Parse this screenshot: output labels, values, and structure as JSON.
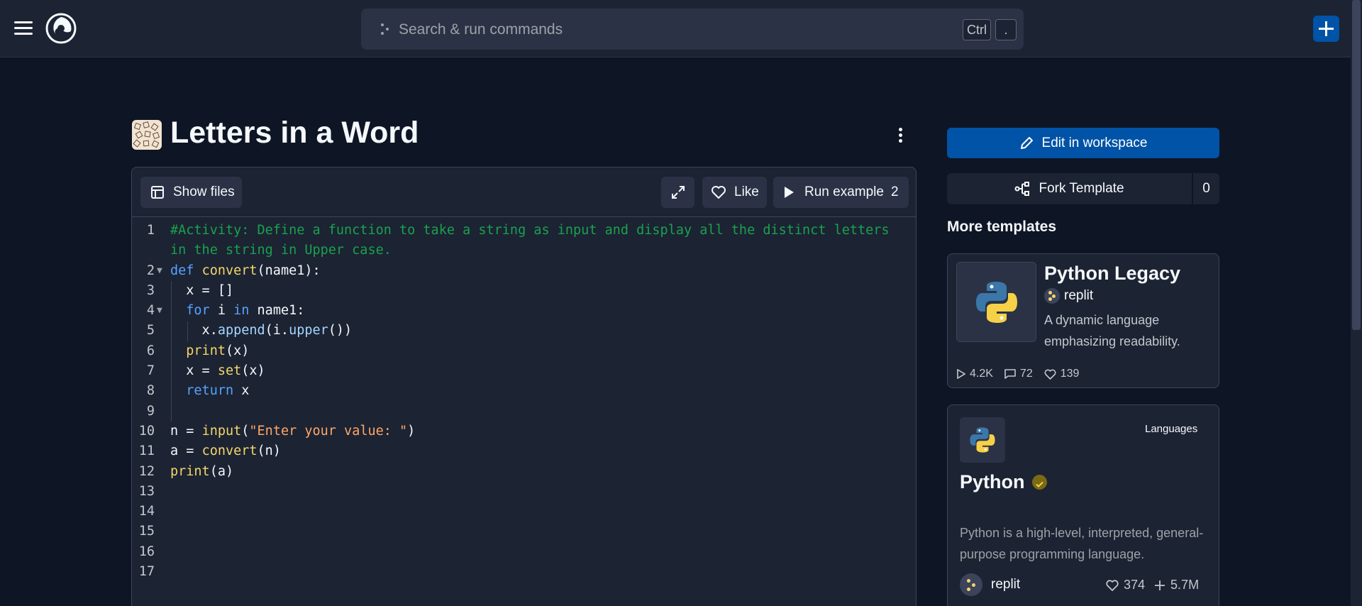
{
  "header": {
    "search_placeholder": "Search & run commands",
    "shortcut_ctrl": "Ctrl",
    "shortcut_key": "."
  },
  "page": {
    "title": "Letters in a Word"
  },
  "toolbar": {
    "show_files": "Show files",
    "like": "Like",
    "run_example": "Run example",
    "run_count": "2"
  },
  "code": {
    "lines": [
      {
        "n": "1",
        "fold": false,
        "tokens": [
          {
            "c": "c-comment",
            "t": "#Activity: Define a function to take a string as input and display all the distinct letters"
          }
        ]
      },
      {
        "n": "",
        "fold": false,
        "tokens": [
          {
            "c": "c-comment",
            "t": "in the string in Upper case."
          }
        ]
      },
      {
        "n": "2",
        "fold": true,
        "tokens": [
          {
            "c": "c-kw",
            "t": "def "
          },
          {
            "c": "c-fn",
            "t": "convert"
          },
          {
            "c": "c-plain",
            "t": "(name1):"
          }
        ]
      },
      {
        "n": "3",
        "fold": false,
        "tokens": [
          {
            "c": "c-plain",
            "t": "  x = []"
          }
        ]
      },
      {
        "n": "4",
        "fold": true,
        "tokens": [
          {
            "c": "c-plain",
            "t": "  "
          },
          {
            "c": "c-kw",
            "t": "for "
          },
          {
            "c": "c-plain",
            "t": "i "
          },
          {
            "c": "c-kw",
            "t": "in "
          },
          {
            "c": "c-plain",
            "t": "name1:"
          }
        ]
      },
      {
        "n": "5",
        "fold": false,
        "tokens": [
          {
            "c": "c-plain",
            "t": "    x."
          },
          {
            "c": "c-method",
            "t": "append"
          },
          {
            "c": "c-plain",
            "t": "(i."
          },
          {
            "c": "c-method",
            "t": "upper"
          },
          {
            "c": "c-plain",
            "t": "())"
          }
        ]
      },
      {
        "n": "6",
        "fold": false,
        "tokens": [
          {
            "c": "c-plain",
            "t": "  "
          },
          {
            "c": "c-fn",
            "t": "print"
          },
          {
            "c": "c-plain",
            "t": "(x)"
          }
        ]
      },
      {
        "n": "7",
        "fold": false,
        "tokens": [
          {
            "c": "c-plain",
            "t": "  x = "
          },
          {
            "c": "c-fn",
            "t": "set"
          },
          {
            "c": "c-plain",
            "t": "(x)"
          }
        ]
      },
      {
        "n": "8",
        "fold": false,
        "tokens": [
          {
            "c": "c-plain",
            "t": "  "
          },
          {
            "c": "c-kw",
            "t": "return "
          },
          {
            "c": "c-plain",
            "t": "x"
          }
        ]
      },
      {
        "n": "9",
        "fold": false,
        "tokens": []
      },
      {
        "n": "10",
        "fold": false,
        "tokens": [
          {
            "c": "c-plain",
            "t": "n = "
          },
          {
            "c": "c-fn",
            "t": "input"
          },
          {
            "c": "c-plain",
            "t": "("
          },
          {
            "c": "c-str",
            "t": "\"Enter your value: \""
          },
          {
            "c": "c-plain",
            "t": ")"
          }
        ]
      },
      {
        "n": "11",
        "fold": false,
        "tokens": [
          {
            "c": "c-plain",
            "t": "a = "
          },
          {
            "c": "c-fn",
            "t": "convert"
          },
          {
            "c": "c-plain",
            "t": "(n)"
          }
        ]
      },
      {
        "n": "12",
        "fold": false,
        "tokens": [
          {
            "c": "c-fn",
            "t": "print"
          },
          {
            "c": "c-plain",
            "t": "(a)"
          }
        ]
      },
      {
        "n": "13",
        "fold": false,
        "tokens": []
      },
      {
        "n": "14",
        "fold": false,
        "tokens": []
      },
      {
        "n": "15",
        "fold": false,
        "tokens": []
      },
      {
        "n": "16",
        "fold": false,
        "tokens": []
      },
      {
        "n": "17",
        "fold": false,
        "tokens": []
      }
    ]
  },
  "sidebar": {
    "edit_label": "Edit in workspace",
    "fork_label": "Fork Template",
    "fork_count": "0",
    "more_heading": "More templates",
    "card1": {
      "name": "Python Legacy",
      "owner": "replit",
      "description": "A dynamic language emphasizing readability.",
      "runs": "4.2K",
      "comments": "72",
      "likes": "139"
    },
    "card2": {
      "badge": "Languages",
      "name": "Python",
      "description": "Python is a high-level, interpreted, general-purpose programming language.",
      "owner": "replit",
      "likes": "374",
      "forks": "5.7M"
    }
  },
  "colors": {
    "background": "#0e1525",
    "surface": "#1c2333",
    "accent": "#0053a6",
    "comment": "#19a24d",
    "keyword": "#56a3ff",
    "function": "#f5d66b",
    "string": "#ffa865"
  }
}
